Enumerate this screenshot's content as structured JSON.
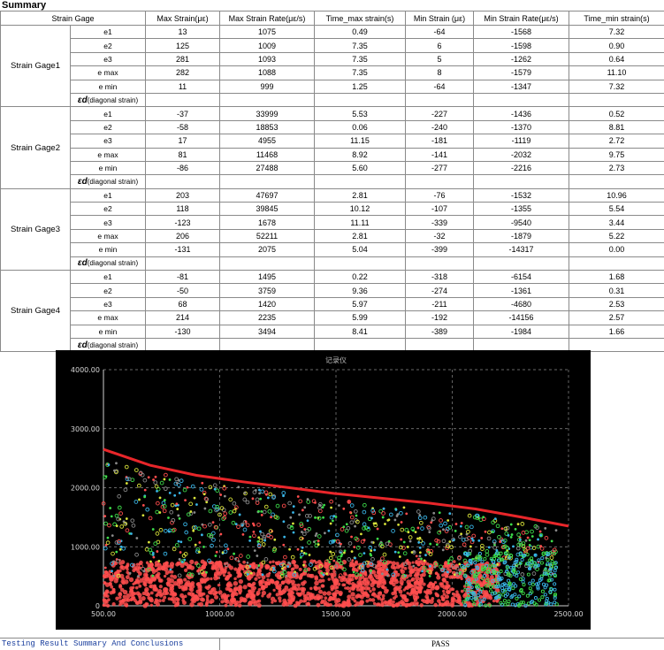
{
  "summary_title": "Summary",
  "table": {
    "headers": [
      "Strain Gage",
      "Max Strain(με)",
      "Max Strain Rate(με/s)",
      "Time_max strain(s)",
      "Min Strain (με)",
      "Min Strain Rate(με/s)",
      "Time_min strain(s)"
    ],
    "diag_label_eps": "εd",
    "diag_label_text": "(diagonal strain)",
    "gages": [
      {
        "name": "Strain Gage1",
        "rows": [
          {
            "label": "e1",
            "values": [
              "13",
              "1075",
              "0.49",
              "-64",
              "-1568",
              "7.32"
            ]
          },
          {
            "label": "e2",
            "values": [
              "125",
              "1009",
              "7.35",
              "6",
              "-1598",
              "0.90"
            ]
          },
          {
            "label": "e3",
            "values": [
              "281",
              "1093",
              "7.35",
              "5",
              "-1262",
              "0.64"
            ]
          },
          {
            "label": "e max",
            "values": [
              "282",
              "1088",
              "7.35",
              "8",
              "-1579",
              "11.10"
            ]
          },
          {
            "label": "e min",
            "values": [
              "11",
              "999",
              "1.25",
              "-64",
              "-1347",
              "7.32"
            ]
          }
        ]
      },
      {
        "name": "Strain Gage2",
        "rows": [
          {
            "label": "e1",
            "values": [
              "-37",
              "33999",
              "5.53",
              "-227",
              "-1436",
              "0.52"
            ]
          },
          {
            "label": "e2",
            "values": [
              "-58",
              "18853",
              "0.06",
              "-240",
              "-1370",
              "8.81"
            ]
          },
          {
            "label": "e3",
            "values": [
              "17",
              "4955",
              "11.15",
              "-181",
              "-1119",
              "2.72"
            ]
          },
          {
            "label": "e max",
            "values": [
              "81",
              "11468",
              "8.92",
              "-141",
              "-2032",
              "9.75"
            ]
          },
          {
            "label": "e min",
            "values": [
              "-86",
              "27488",
              "5.60",
              "-277",
              "-2216",
              "2.73"
            ]
          }
        ]
      },
      {
        "name": "Strain Gage3",
        "rows": [
          {
            "label": "e1",
            "values": [
              "203",
              "47697",
              "2.81",
              "-76",
              "-1532",
              "10.96"
            ]
          },
          {
            "label": "e2",
            "values": [
              "118",
              "39845",
              "10.12",
              "-107",
              "-1355",
              "5.54"
            ]
          },
          {
            "label": "e3",
            "values": [
              "-123",
              "1678",
              "11.11",
              "-339",
              "-9540",
              "3.44"
            ]
          },
          {
            "label": "e max",
            "values": [
              "206",
              "52211",
              "2.81",
              "-32",
              "-1879",
              "5.22"
            ]
          },
          {
            "label": "e min",
            "values": [
              "-131",
              "2075",
              "5.04",
              "-399",
              "-14317",
              "0.00"
            ]
          }
        ]
      },
      {
        "name": "Strain Gage4",
        "rows": [
          {
            "label": "e1",
            "values": [
              "-81",
              "1495",
              "0.22",
              "-318",
              "-6154",
              "1.68"
            ]
          },
          {
            "label": "e2",
            "values": [
              "-50",
              "3759",
              "9.36",
              "-274",
              "-1361",
              "0.31"
            ]
          },
          {
            "label": "e3",
            "values": [
              "68",
              "1420",
              "5.97",
              "-211",
              "-4680",
              "2.53"
            ]
          },
          {
            "label": "e max",
            "values": [
              "214",
              "2235",
              "5.99",
              "-192",
              "-14156",
              "2.57"
            ]
          },
          {
            "label": "e min",
            "values": [
              "-130",
              "3494",
              "8.41",
              "-389",
              "-1984",
              "1.66"
            ]
          }
        ]
      }
    ]
  },
  "chart_data": {
    "type": "scatter",
    "title": "记录仪",
    "xlim": [
      500,
      2500
    ],
    "ylim": [
      0,
      4000
    ],
    "x_ticks": [
      500,
      1000,
      1500,
      2000,
      2500
    ],
    "y_ticks": [
      0,
      1000,
      2000,
      3000,
      4000
    ],
    "x_tick_labels": [
      "500.00",
      "1000.00",
      "1500.00",
      "2000.00",
      "2500.00"
    ],
    "y_tick_labels": [
      "0",
      "1000.00",
      "2000.00",
      "3000.00",
      "4000.00"
    ],
    "grid": true,
    "colors": {
      "background": "#000000",
      "curve": "#e8262a",
      "points": [
        "#ff4d4d",
        "#3ddc4a",
        "#d8e23a",
        "#39b4e6",
        "#8a8a8a"
      ]
    },
    "curve": {
      "x": [
        500,
        700,
        900,
        1100,
        1300,
        1500,
        1700,
        1900,
        2100,
        2300,
        2500
      ],
      "y": [
        2650,
        2380,
        2210,
        2100,
        2000,
        1900,
        1820,
        1740,
        1640,
        1500,
        1350
      ]
    }
  },
  "footer": {
    "left_text": "Testing Result Summary And Conclusions",
    "right_text": "PASS"
  }
}
